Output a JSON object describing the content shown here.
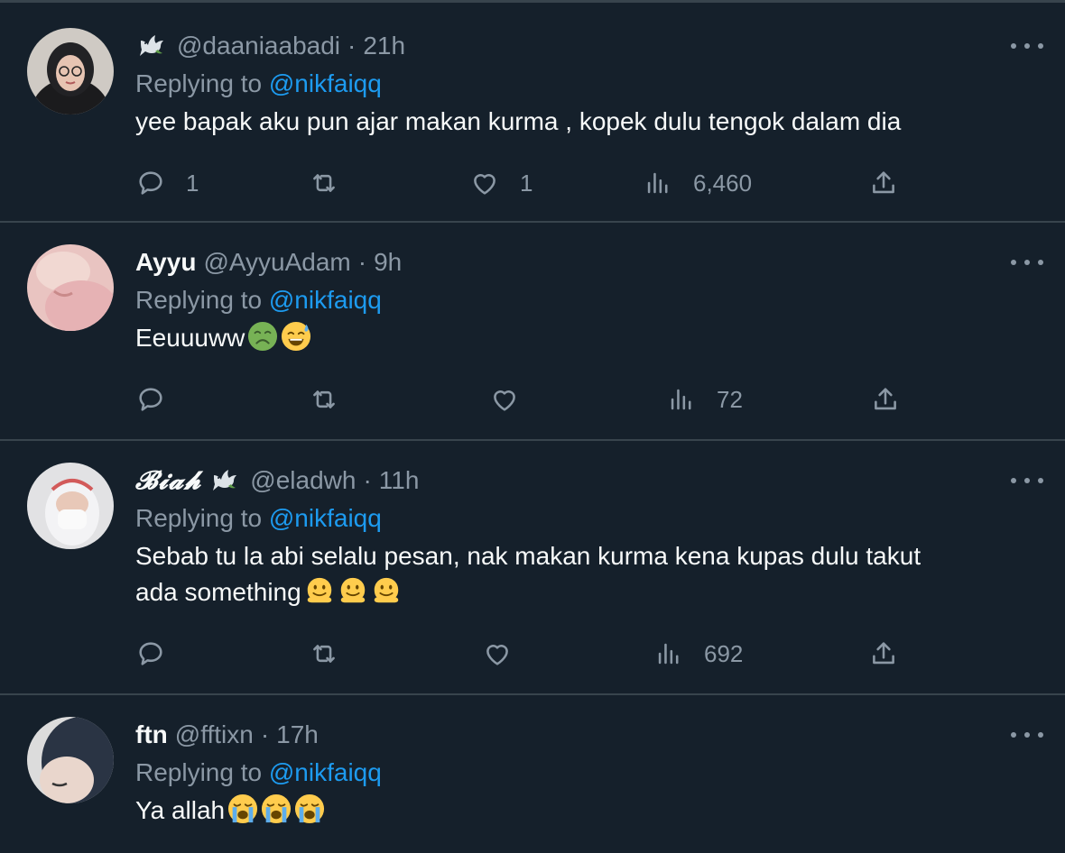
{
  "tweets": [
    {
      "display_name": "",
      "handle": "@daaniaabadi",
      "dot": "·",
      "time": "21h",
      "replying_prefix": "Replying to",
      "replying_to": "@nikfaiqq",
      "text": "yee bapak aku pun ajar makan kurma , kopek dulu tengok dalam dia",
      "emojis": [],
      "badge": "dove-icon",
      "stats": {
        "replies": "1",
        "retweets": "",
        "likes": "1",
        "views": "6,460"
      }
    },
    {
      "display_name": "Ayyu",
      "handle": "@AyyuAdam",
      "dot": "·",
      "time": "9h",
      "replying_prefix": "Replying to",
      "replying_to": "@nikfaiqq",
      "text": "Eeuuuww",
      "emojis": [
        "nauseated-face-emoji",
        "grinning-sweat-emoji"
      ],
      "stats": {
        "replies": "",
        "retweets": "",
        "likes": "",
        "views": "72"
      }
    },
    {
      "display_name": "𝓑𝓲𝓪𝓱",
      "handle": "@eladwh",
      "dot": "·",
      "time": "11h",
      "replying_prefix": "Replying to",
      "replying_to": "@nikfaiqq",
      "text_line1": "Sebab tu la abi selalu pesan, nak makan kurma kena kupas dulu takut",
      "text_line2": "ada something",
      "emojis": [
        "melting-face-emoji",
        "melting-face-emoji",
        "melting-face-emoji"
      ],
      "badge": "dove-icon",
      "stats": {
        "replies": "",
        "retweets": "",
        "likes": "",
        "views": "692"
      }
    },
    {
      "display_name": "ftn",
      "handle": "@fftixn",
      "dot": "·",
      "time": "17h",
      "replying_prefix": "Replying to",
      "replying_to": "@nikfaiqq",
      "text": "Ya allah",
      "emojis": [
        "loudly-crying-face-emoji",
        "loudly-crying-face-emoji",
        "loudly-crying-face-emoji"
      ]
    }
  ],
  "colors": {
    "background": "#15202b",
    "divider": "#38444d",
    "primary_text": "#f7f9f9",
    "secondary_text": "#8b98a5",
    "mention": "#1d9bf0"
  }
}
